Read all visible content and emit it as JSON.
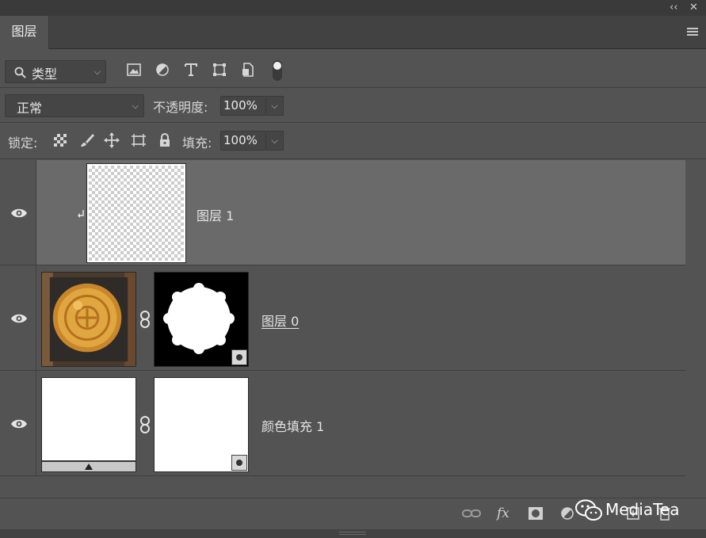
{
  "window": {
    "collapse_glyph": "‹‹",
    "close_glyph": "✕"
  },
  "tab": {
    "label": "图层"
  },
  "filter": {
    "kind_label": "类型",
    "icons": [
      "image-filter-icon",
      "adjustment-filter-icon",
      "type-filter-icon",
      "shape-filter-icon",
      "smart-object-filter-icon",
      "filter-toggle-icon"
    ]
  },
  "blend": {
    "mode": "正常",
    "opacity_label": "不透明度:",
    "opacity_value": "100%"
  },
  "lock": {
    "label": "锁定:",
    "fill_label": "填充:",
    "fill_value": "100%"
  },
  "layers": [
    {
      "name": "图层 1",
      "type": "empty",
      "selected": true,
      "clipped": true
    },
    {
      "name": "图层 0",
      "type": "image-with-mask"
    },
    {
      "name": "颜色填充 1",
      "type": "fill-with-mask"
    }
  ],
  "watermark": {
    "text": "MediaTea"
  },
  "colors": {
    "panel": "#535353",
    "selected_row": "#6a6a6a",
    "header": "#424242"
  }
}
